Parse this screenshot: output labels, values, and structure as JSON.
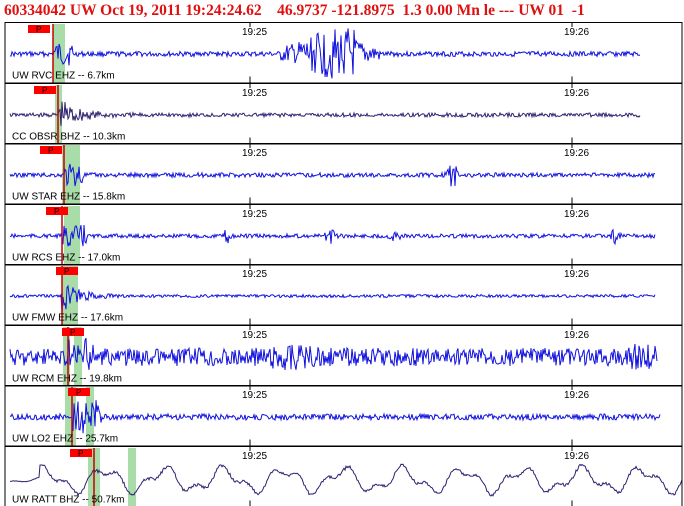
{
  "header": {
    "event_id": "60334042",
    "network": "UW",
    "origin": "Oct 19, 2011 19:24:24.62",
    "lat": "46.9737",
    "lon": "-121.8975",
    "magnitude": "1.3",
    "mag_extra": "0.00",
    "mag_type": "Mn",
    "type": "le",
    "dashes": "---",
    "source": "UW",
    "version": "01",
    "trailing": "-1"
  },
  "ticks": [
    "19:25",
    "19:26"
  ],
  "phase_label": "P",
  "colors": {
    "trace": "#1010e0",
    "trace_dark": "#302070",
    "phase_box": "#ff0000",
    "pick_line": "#c80000",
    "window_band": "#a8dca8",
    "header": "#e01010",
    "border": "#000000"
  },
  "stations": [
    {
      "label": "UW RVC EHZ -- 6.7km",
      "phase": "P"
    },
    {
      "label": "CC OBSR BHZ -- 10.3km",
      "phase": "P"
    },
    {
      "label": "UW STAR EHZ -- 15.8km",
      "phase": "P"
    },
    {
      "label": "UW RCS EHZ -- 17.0km",
      "phase": "P"
    },
    {
      "label": "UW FMW EHZ -- 17.6km",
      "phase": "P"
    },
    {
      "label": "UW RCM EHZ -- 19.8km",
      "phase": "P"
    },
    {
      "label": "UW LO2 EHZ -- 25.7km",
      "phase": "P"
    },
    {
      "label": "UW RATT BHZ -- 50.7km",
      "phase": "P"
    }
  ]
}
